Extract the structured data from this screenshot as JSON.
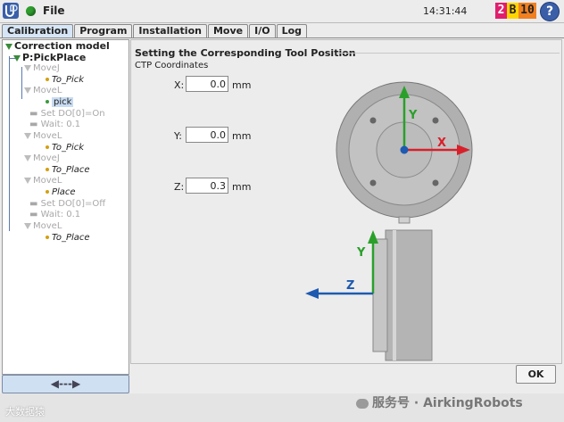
{
  "header": {
    "menu_label": "File",
    "time": "14:31:44",
    "badge": [
      "2",
      "B",
      "10"
    ],
    "help_label": "?"
  },
  "tabs": [
    {
      "label": "Calibration",
      "active": true
    },
    {
      "label": "Program",
      "active": false
    },
    {
      "label": "Installation",
      "active": false
    },
    {
      "label": "Move",
      "active": false
    },
    {
      "label": "I/O",
      "active": false
    },
    {
      "label": "Log",
      "active": false
    }
  ],
  "tree": {
    "root": "Correction model",
    "program": "P:PickPlace",
    "nodes": [
      {
        "label": "MoveJ"
      },
      {
        "label": "To_Pick"
      },
      {
        "label": "MoveL"
      },
      {
        "label": "pick"
      },
      {
        "label": "Set DO[0]=On"
      },
      {
        "label": "Wait: 0.1"
      },
      {
        "label": "MoveL"
      },
      {
        "label": "To_Pick"
      },
      {
        "label": "MoveJ"
      },
      {
        "label": "To_Place"
      },
      {
        "label": "MoveL"
      },
      {
        "label": "Place"
      },
      {
        "label": "Set DO[0]=Off"
      },
      {
        "label": "Wait: 0.1"
      },
      {
        "label": "MoveL"
      },
      {
        "label": "To_Place"
      }
    ],
    "nav_label": "◀---▶"
  },
  "panel": {
    "title": "Setting the Corresponding Tool Position",
    "subtitle": "CTP Coordinates",
    "fields": [
      {
        "label": "X:",
        "value": "0.0",
        "unit": "mm"
      },
      {
        "label": "Y:",
        "value": "0.0",
        "unit": "mm"
      },
      {
        "label": "Z:",
        "value": "0.3",
        "unit": "mm"
      }
    ],
    "axes": {
      "x": "X",
      "y": "Y",
      "y2": "Y",
      "z": "Z"
    },
    "ok_label": "OK"
  },
  "watermark": {
    "left": "大数据猿",
    "right": "服务号 · AirkingRobots"
  },
  "colors": {
    "x_axis": "#d8202a",
    "y_axis": "#2aa02a",
    "z_axis": "#1e5ab0",
    "tab_active": "#d6e6f6",
    "selection": "#c8dcf2"
  }
}
